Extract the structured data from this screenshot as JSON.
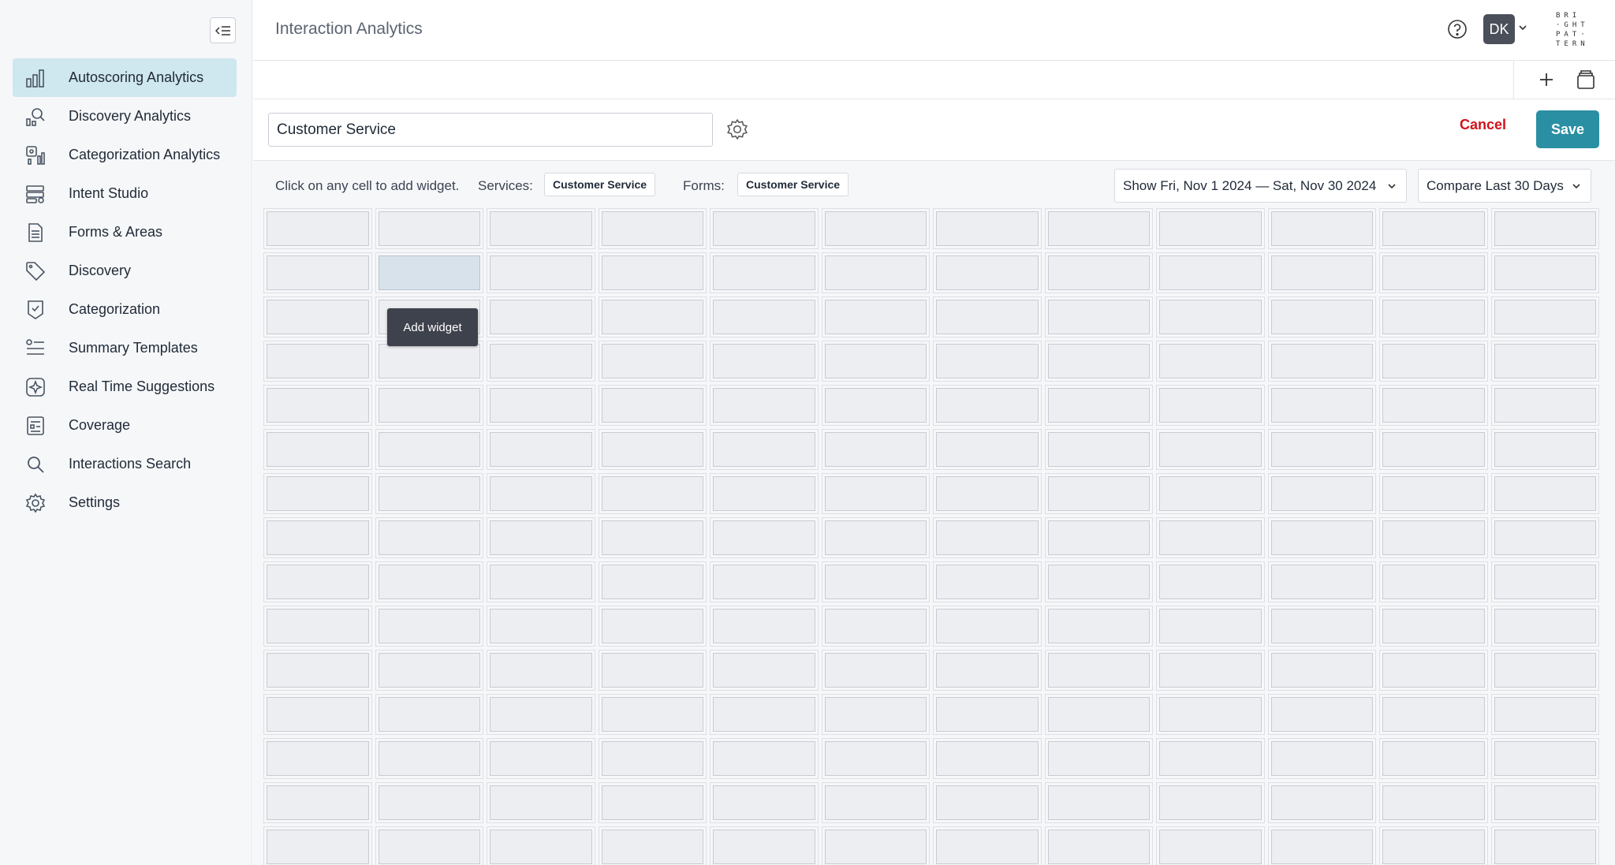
{
  "header": {
    "title": "Interaction Analytics",
    "avatar_initials": "DK",
    "logo_lines": [
      "BRI",
      "·GHT",
      "PAT·",
      "TERN"
    ]
  },
  "sidebar": {
    "items": [
      {
        "label": "Autoscoring Analytics",
        "icon": "bar-chart-icon",
        "active": true
      },
      {
        "label": "Discovery Analytics",
        "icon": "discovery-analytics-icon"
      },
      {
        "label": "Categorization Analytics",
        "icon": "categorization-analytics-icon"
      },
      {
        "label": "Intent Studio",
        "icon": "intent-studio-icon"
      },
      {
        "label": "Forms & Areas",
        "icon": "form-document-icon"
      },
      {
        "label": "Discovery",
        "icon": "tag-icon"
      },
      {
        "label": "Categorization",
        "icon": "categorization-icon"
      },
      {
        "label": "Summary Templates",
        "icon": "summary-list-icon"
      },
      {
        "label": "Real Time Suggestions",
        "icon": "sparkle-icon"
      },
      {
        "label": "Coverage",
        "icon": "coverage-icon"
      },
      {
        "label": "Interactions Search",
        "icon": "search-icon"
      },
      {
        "label": "Settings",
        "icon": "gear-icon"
      }
    ]
  },
  "editor": {
    "dashboard_name": "Customer Service",
    "cancel_label": "Cancel",
    "save_label": "Save"
  },
  "filters": {
    "hint": "Click on any cell to add widget.",
    "services_label": "Services:",
    "services_value": "Customer Service",
    "forms_label": "Forms:",
    "forms_value": "Customer Service",
    "date_range": "Show Fri, Nov 1 2024 — Sat, Nov 30 2024",
    "compare": "Compare Last 30 Days"
  },
  "grid": {
    "columns": 12,
    "rows": 15,
    "hover_cell": {
      "row": 2,
      "col": 2
    },
    "tooltip": "Add widget"
  },
  "colors": {
    "accent": "#2b8fa3",
    "active_nav": "#cfe7ee",
    "cancel": "#d0121b"
  }
}
